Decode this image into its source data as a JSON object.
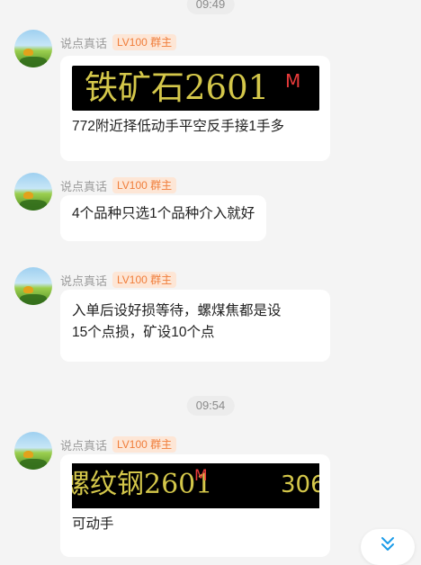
{
  "timestamps": [
    "09:49",
    "09:54"
  ],
  "messages": [
    {
      "sender": "说点真话",
      "badge": "LV100 群主",
      "ticker": {
        "name": "铁矿石2601",
        "marker": "M"
      },
      "text": "772附近择低动手平空反手接1手多"
    },
    {
      "sender": "说点真话",
      "badge": "LV100 群主",
      "text": "4个品种只选1个品种介入就好"
    },
    {
      "sender": "说点真话",
      "badge": "LV100 群主",
      "text_lines": [
        "入单后设好损等待，螺煤焦都是设",
        "15个点损，矿设10个点"
      ]
    },
    {
      "sender": "说点真话",
      "badge": "LV100 群主",
      "ticker": {
        "name": "螺纹钢2601",
        "marker": "M",
        "value": "306"
      },
      "text": "可动手"
    }
  ],
  "scroll_button": {
    "icon": "double-chevron-down-icon",
    "color": "#1a9be8"
  },
  "colors": {
    "badge_bg": "#fde6d6",
    "badge_text": "#f07d3a",
    "ticker_text": "#d4c74a",
    "ticker_marker": "#e83a3a"
  }
}
